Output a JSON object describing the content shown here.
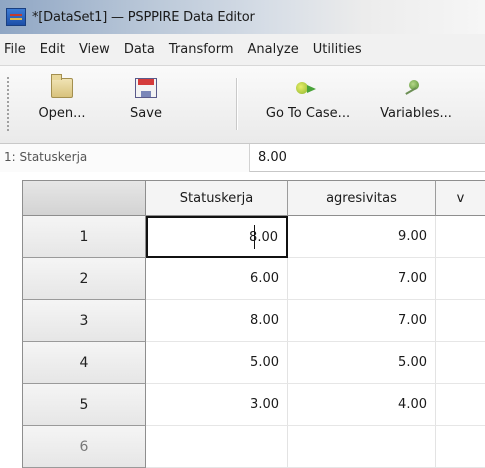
{
  "window": {
    "title": "*[DataSet1] — PSPPIRE Data Editor"
  },
  "menu": [
    "File",
    "Edit",
    "View",
    "Data",
    "Transform",
    "Analyze",
    "Utilities"
  ],
  "toolbar": {
    "open_label": "Open...",
    "save_label": "Save",
    "goto_label": "Go To Case...",
    "variables_label": "Variables..."
  },
  "cell_info": {
    "reference": "1: Statuskerja",
    "value": "8.00"
  },
  "grid": {
    "columns": [
      "Statuskerja",
      "agresivitas",
      "v"
    ],
    "rows": [
      {
        "num": "1",
        "cells": [
          "8.00",
          "9.00"
        ]
      },
      {
        "num": "2",
        "cells": [
          "6.00",
          "7.00"
        ]
      },
      {
        "num": "3",
        "cells": [
          "8.00",
          "7.00"
        ]
      },
      {
        "num": "4",
        "cells": [
          "5.00",
          "5.00"
        ]
      },
      {
        "num": "5",
        "cells": [
          "3.00",
          "4.00"
        ]
      },
      {
        "num": "6",
        "cells": [
          "",
          ""
        ]
      }
    ]
  }
}
